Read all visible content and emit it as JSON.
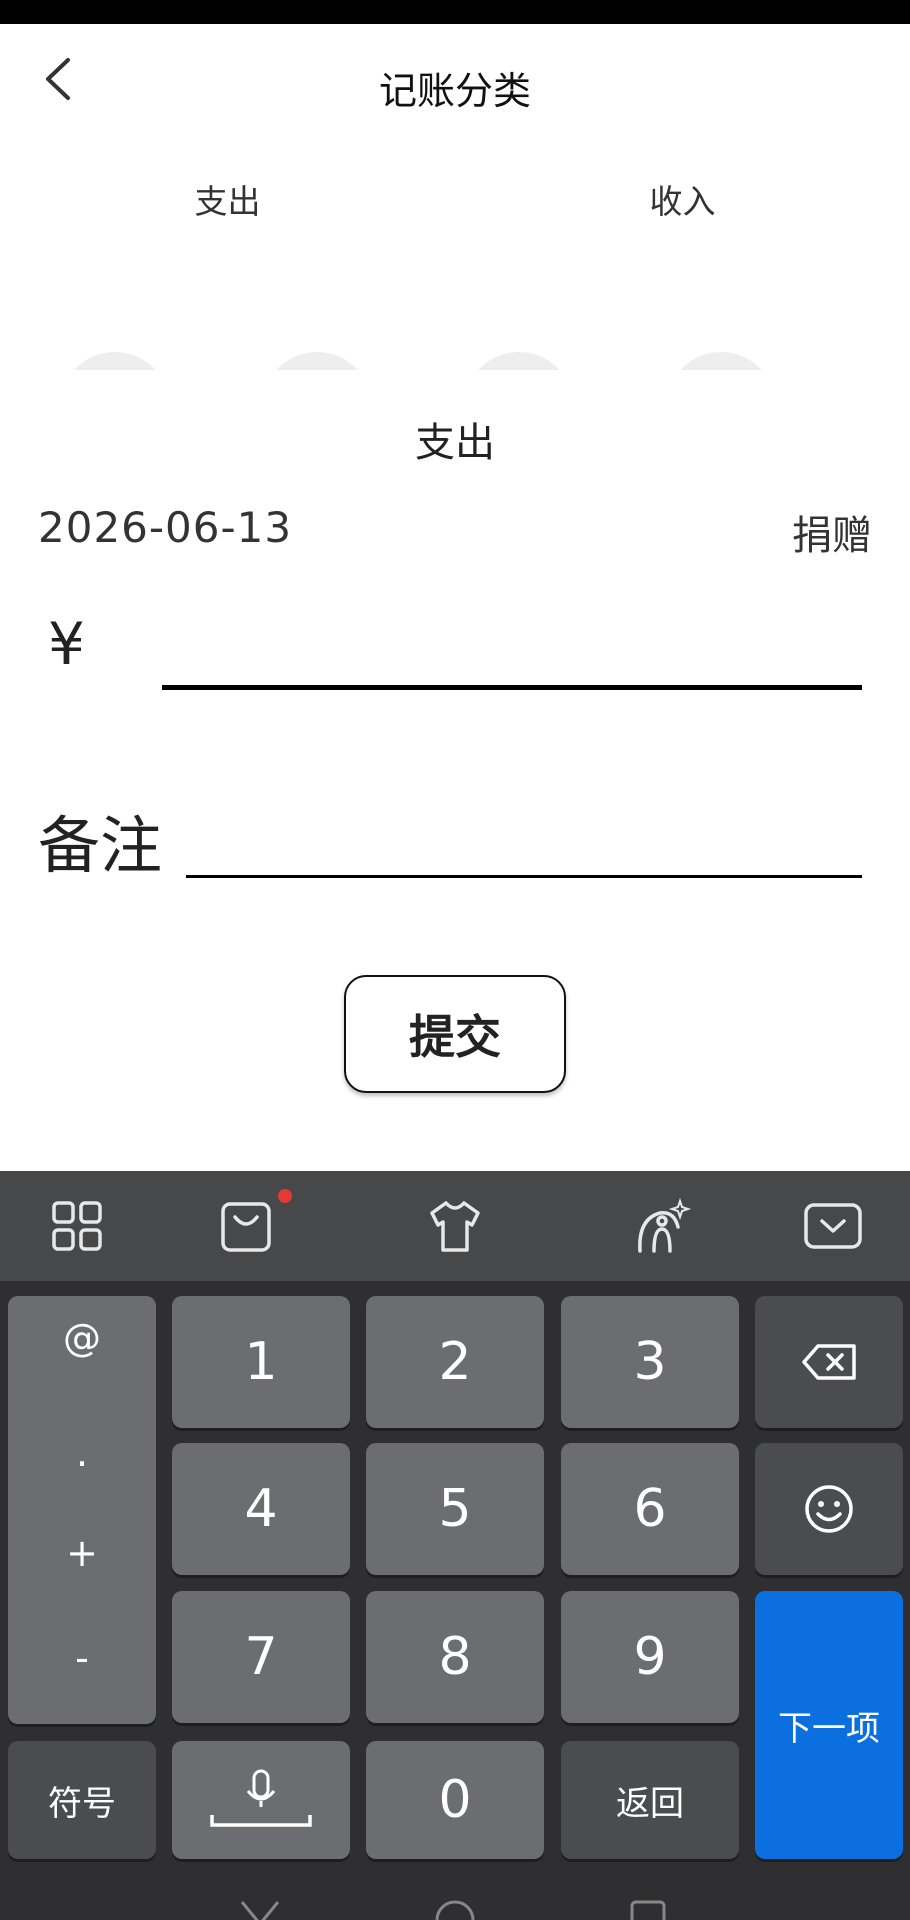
{
  "header": {
    "title": "记账分类"
  },
  "tabs": [
    {
      "label": "支出"
    },
    {
      "label": "收入"
    }
  ],
  "form": {
    "section_label": "支出",
    "date": "2026-06-13",
    "category": "捐赠",
    "currency_symbol": "¥",
    "amount_value": "",
    "remark_label": "备注",
    "remark_value": "",
    "submit_label": "提交"
  },
  "keyboard": {
    "toolbar_icons": [
      "apps-grid-icon",
      "shop-bag-icon",
      "tshirt-skin-icon",
      "ai-assistant-icon",
      "keyboard-hide-icon"
    ],
    "side_chars": [
      "@",
      ".",
      "+",
      "-"
    ],
    "keys": {
      "k1": "1",
      "k2": "2",
      "k3": "3",
      "k4": "4",
      "k5": "5",
      "k6": "6",
      "k7": "7",
      "k8": "8",
      "k9": "9",
      "k0": "0",
      "symbols": "符号",
      "back": "返回",
      "next": "下一项"
    }
  },
  "colors": {
    "keyboard_bg": "#2f2f31",
    "key_bg": "#6c6d70",
    "key_dark_bg": "#4b4c4f",
    "accent_blue": "#0b6fe0",
    "notification_red": "#e53935"
  }
}
